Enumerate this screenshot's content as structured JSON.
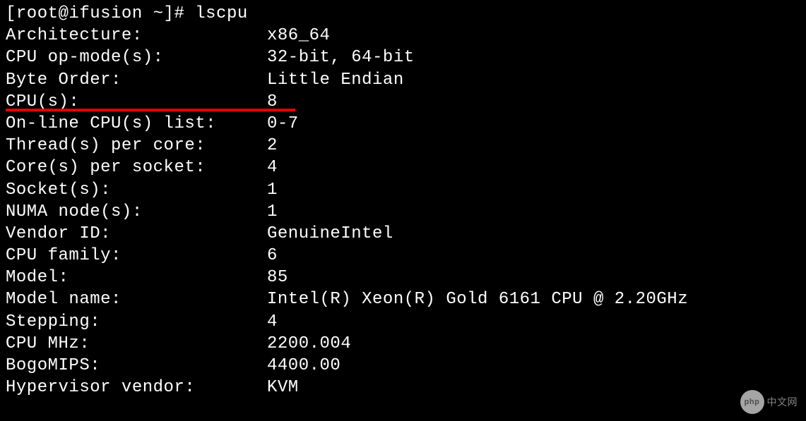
{
  "prompt": "[root@ifusion ~]# ",
  "command": "lscpu",
  "output": [
    {
      "key": "Architecture:",
      "value": "x86_64"
    },
    {
      "key": "CPU op-mode(s):",
      "value": "32-bit, 64-bit"
    },
    {
      "key": "Byte Order:",
      "value": "Little Endian"
    },
    {
      "key": "CPU(s):",
      "value": "8"
    },
    {
      "key": "On-line CPU(s) list:",
      "value": "0-7"
    },
    {
      "key": "Thread(s) per core:",
      "value": "2"
    },
    {
      "key": "Core(s) per socket:",
      "value": "4"
    },
    {
      "key": "Socket(s):",
      "value": "1"
    },
    {
      "key": "NUMA node(s):",
      "value": "1"
    },
    {
      "key": "Vendor ID:",
      "value": "GenuineIntel"
    },
    {
      "key": "CPU family:",
      "value": "6"
    },
    {
      "key": "Model:",
      "value": "85"
    },
    {
      "key": "Model name:",
      "value": "Intel(R) Xeon(R) Gold 6161 CPU @ 2.20GHz"
    },
    {
      "key": "Stepping:",
      "value": "4"
    },
    {
      "key": "CPU MHz:",
      "value": "2200.004"
    },
    {
      "key": "BogoMIPS:",
      "value": "4400.00"
    },
    {
      "key": "Hypervisor vendor:",
      "value": "KVM"
    }
  ],
  "watermark": {
    "logo_text": "php",
    "label": "中文网"
  },
  "highlight_row_index": 3
}
